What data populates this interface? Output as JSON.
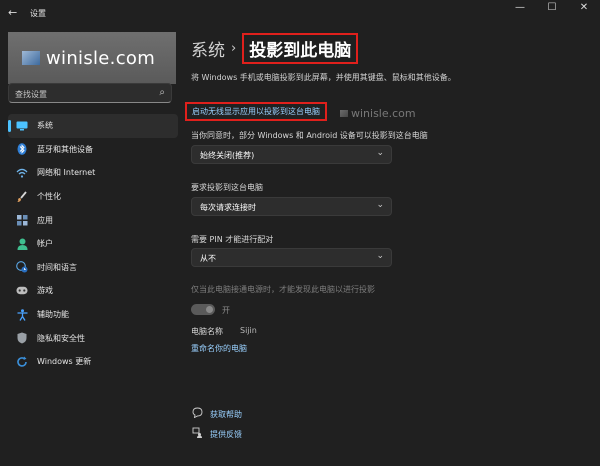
{
  "window": {
    "title": "设置",
    "back": "←",
    "minimize": "—",
    "maximize": "☐",
    "close": "✕"
  },
  "sidebar": {
    "watermark": "winisle.com",
    "search": {
      "placeholder": "查找设置",
      "icon": "search-icon"
    },
    "items": [
      {
        "label": "系统",
        "icon": "monitor-icon",
        "color": "#4cc2ff",
        "active": true
      },
      {
        "label": "蓝牙和其他设备",
        "icon": "bluetooth-icon",
        "color": "#4a9fe8"
      },
      {
        "label": "网络和 Internet",
        "icon": "wifi-icon",
        "color": "#6fb3e8"
      },
      {
        "label": "个性化",
        "icon": "brush-icon",
        "color": "#e0a060"
      },
      {
        "label": "应用",
        "icon": "apps-icon",
        "color": "#7aa7d6"
      },
      {
        "label": "帐户",
        "icon": "person-icon",
        "color": "#3fbf8f"
      },
      {
        "label": "时间和语言",
        "icon": "globe-clock-icon",
        "color": "#5aa7e6"
      },
      {
        "label": "游戏",
        "icon": "gamepad-icon",
        "color": "#bdbdbd"
      },
      {
        "label": "辅助功能",
        "icon": "accessibility-icon",
        "color": "#4aa3ff"
      },
      {
        "label": "隐私和安全性",
        "icon": "shield-icon",
        "color": "#9aa0a6"
      },
      {
        "label": "Windows 更新",
        "icon": "update-icon",
        "color": "#3a8fd9"
      }
    ]
  },
  "main": {
    "breadcrumb_root": "系统",
    "breadcrumb_sep": "›",
    "page_title": "投影到此电脑",
    "description": "将 Windows 手机或电脑投影到此屏幕，并使用其键盘、鼠标和其他设备。",
    "link_wireless_display": "启动无线显示应用以投影到这台电脑",
    "watermark_small": "winisle.com",
    "setting1": {
      "label": "当你同意时，部分 Windows 和 Android 设备可以投影到这台电脑",
      "value": "始终关闭(推荐)"
    },
    "setting2": {
      "label": "要求投影到这台电脑",
      "value": "每次请求连接时"
    },
    "setting3": {
      "label": "需要 PIN 才能进行配对",
      "value": "从不"
    },
    "power_label": "仅当此电脑接通电源时，才能发现此电脑以进行投影",
    "power_toggle_text": "开",
    "pc_name_label": "电脑名称",
    "pc_name_value": "Sijin",
    "rename_link": "重命名你的电脑",
    "help_link": "获取帮助",
    "feedback_link": "提供反馈",
    "chevron": "⌄"
  },
  "colors": {
    "background": "#202020",
    "accent": "#4cc2ff",
    "link": "#9ad1ff",
    "highlight_box": "#e0201c"
  }
}
